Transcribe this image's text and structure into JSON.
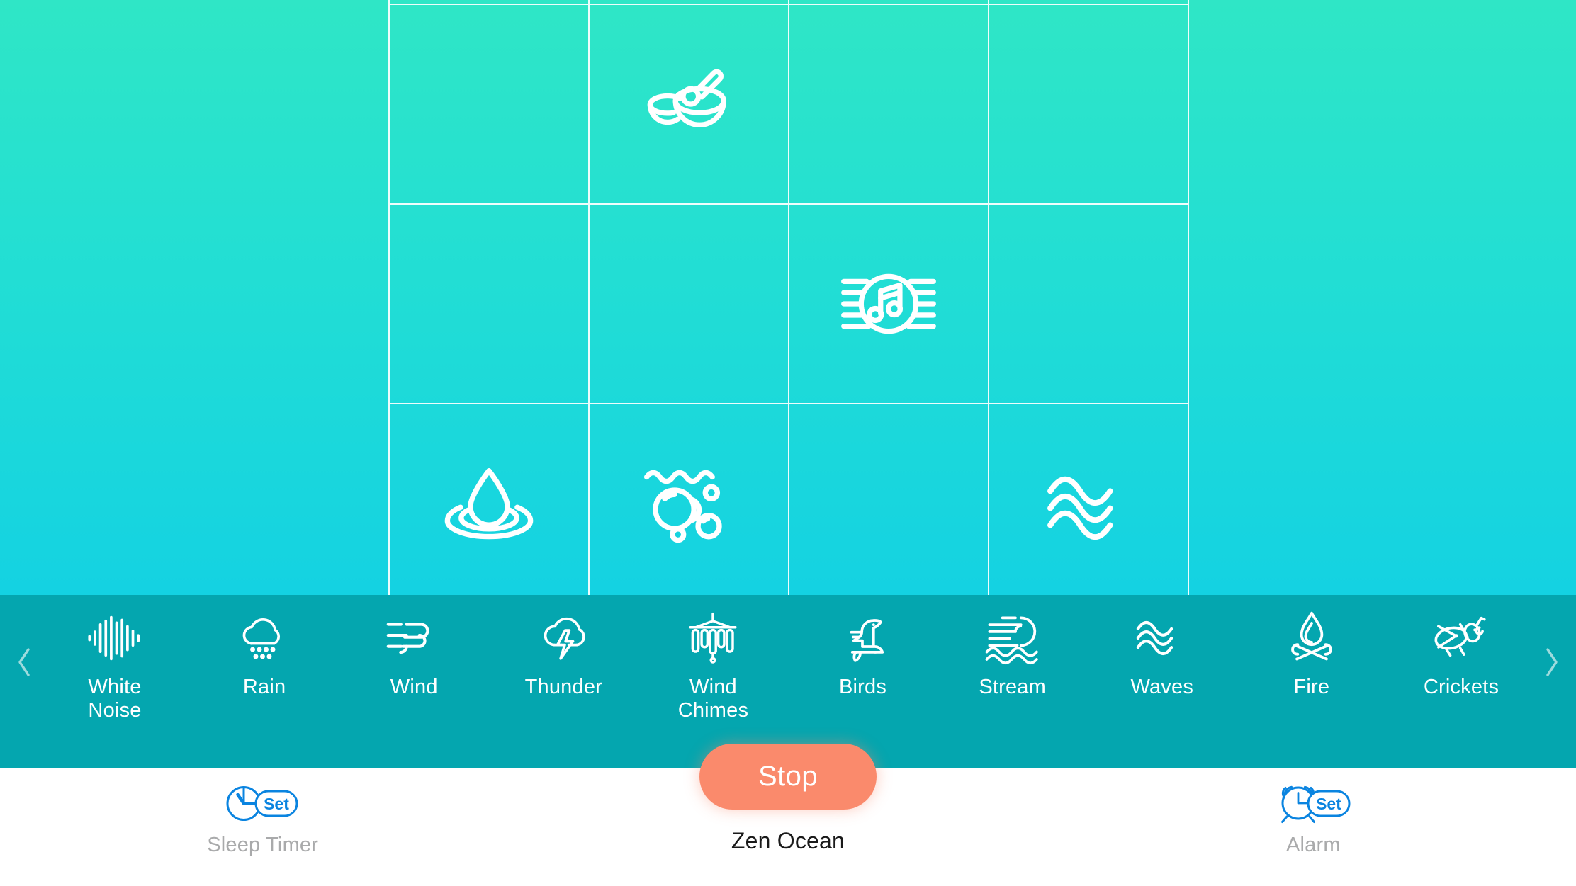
{
  "app": {
    "now_playing": "Zen Ocean",
    "colors": {
      "gradient_top": "#2fe6c6",
      "gradient_bottom": "#14d2e2",
      "strip_bg": "#04a6af",
      "stop_button": "#fa8a6c",
      "accent_blue": "#0a84e0",
      "label_grey": "#a9aaab"
    }
  },
  "mixer": {
    "columns": 4,
    "cells": [
      {
        "icon": "none",
        "active": false
      },
      {
        "icon": "none",
        "active": false
      },
      {
        "icon": "none",
        "active": false
      },
      {
        "icon": "none",
        "active": false
      },
      {
        "icon": "none",
        "active": false
      },
      {
        "icon": "singing-bowls-icon",
        "active": true
      },
      {
        "icon": "none",
        "active": false
      },
      {
        "icon": "none",
        "active": false
      },
      {
        "icon": "none",
        "active": false
      },
      {
        "icon": "none",
        "active": false
      },
      {
        "icon": "melody-note-icon",
        "active": true
      },
      {
        "icon": "none",
        "active": false
      },
      {
        "icon": "water-drop-icon",
        "active": true
      },
      {
        "icon": "bubbles-icon",
        "active": true
      },
      {
        "icon": "none",
        "active": false
      },
      {
        "icon": "waves-icon",
        "active": true
      }
    ]
  },
  "strip": {
    "prev_arrow": "chevron-left-icon",
    "next_arrow": "chevron-right-icon",
    "sounds": [
      {
        "label": "White\nNoise",
        "icon": "white-noise-icon"
      },
      {
        "label": "Rain",
        "icon": "rain-cloud-icon"
      },
      {
        "label": "Wind",
        "icon": "wind-icon"
      },
      {
        "label": "Thunder",
        "icon": "thunder-cloud-icon"
      },
      {
        "label": "Wind\nChimes",
        "icon": "wind-chimes-icon"
      },
      {
        "label": "Birds",
        "icon": "bird-icon"
      },
      {
        "label": "Stream",
        "icon": "stream-icon"
      },
      {
        "label": "Waves",
        "icon": "waves-icon"
      },
      {
        "label": "Fire",
        "icon": "campfire-icon"
      },
      {
        "label": "Crickets",
        "icon": "cricket-icon"
      }
    ]
  },
  "controls": {
    "sleep_timer": {
      "label": "Sleep Timer",
      "icon": "timer-set-icon",
      "badge": "Set"
    },
    "stop": {
      "label": "Stop"
    },
    "alarm": {
      "label": "Alarm",
      "icon": "alarm-set-icon",
      "badge": "Set"
    }
  }
}
